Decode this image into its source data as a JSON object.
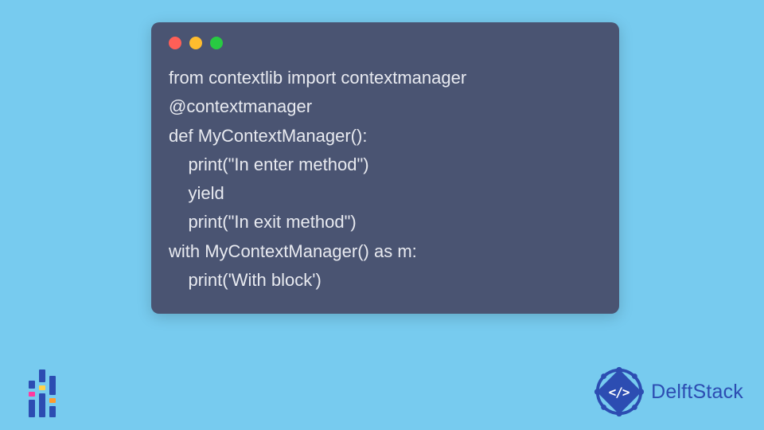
{
  "colors": {
    "page_bg": "#77cbef",
    "window_bg": "#4a5472",
    "code_text": "#e8eaf0",
    "traffic_red": "#ff5f57",
    "traffic_yellow": "#ffbd2e",
    "traffic_green": "#28ca42",
    "brand_blue": "#2c4db2"
  },
  "code": {
    "lines": [
      "from contextlib import contextmanager",
      "@contextmanager",
      "def MyContextManager():",
      "    print(\"In enter method\")",
      "    yield",
      "    print(\"In exit method\")",
      "with MyContextManager() as m:",
      "    print('With block')"
    ]
  },
  "brand": {
    "name": "DelftStack",
    "badge_glyph": "</>"
  }
}
